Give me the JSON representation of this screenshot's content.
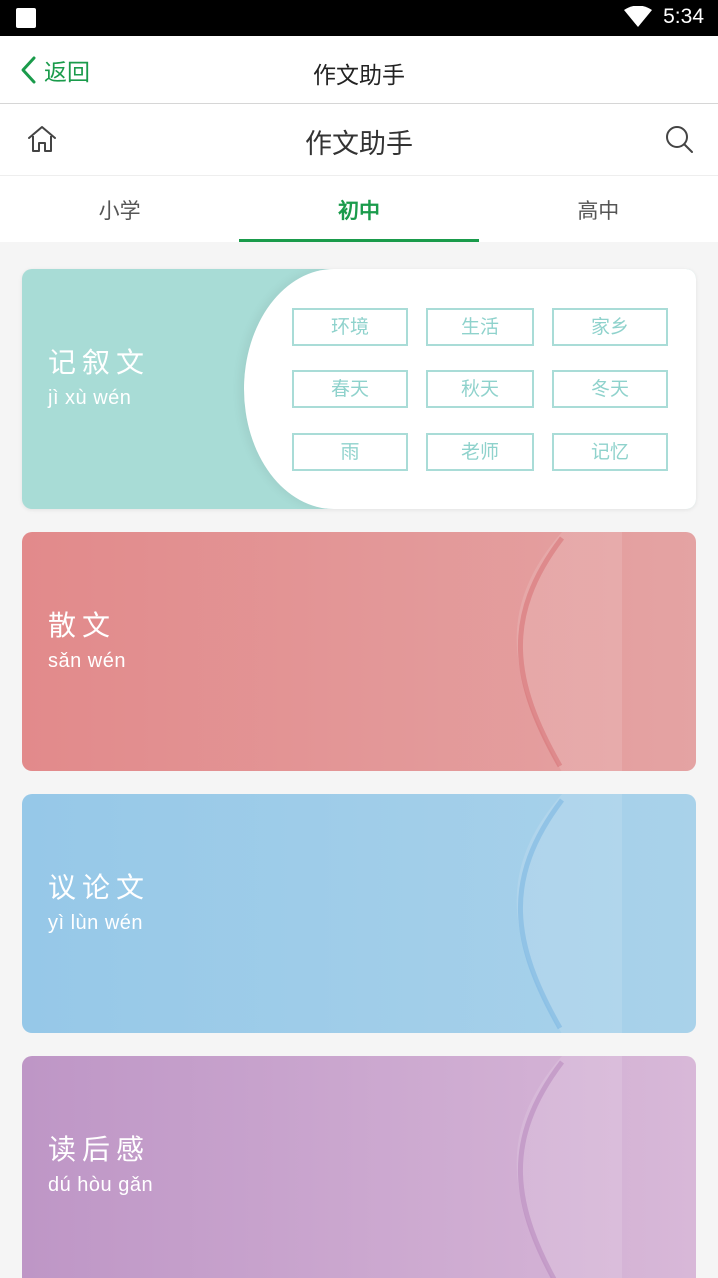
{
  "status_bar": {
    "time": "5:34"
  },
  "nav": {
    "back_label": "返回",
    "title": "作文助手"
  },
  "header": {
    "title": "作文助手"
  },
  "tabs": [
    {
      "label": "小学",
      "active": false
    },
    {
      "label": "初中",
      "active": true
    },
    {
      "label": "高中",
      "active": false
    }
  ],
  "categories": [
    {
      "title": "记叙文",
      "pinyin": "jì xù wén",
      "color": "#a8dcd6",
      "topics": [
        "环境",
        "生活",
        "家乡",
        "春天",
        "秋天",
        "冬天",
        "雨",
        "老师",
        "记忆"
      ]
    },
    {
      "title": "散文",
      "pinyin": "sǎn wén",
      "color": "#e28a8b"
    },
    {
      "title": "议论文",
      "pinyin": "yì lùn wén",
      "color": "#96c8e8"
    },
    {
      "title": "读后感",
      "pinyin": "dú hòu gǎn",
      "color": "#be96c6"
    }
  ],
  "colors": {
    "accent": "#1a9b4b"
  }
}
